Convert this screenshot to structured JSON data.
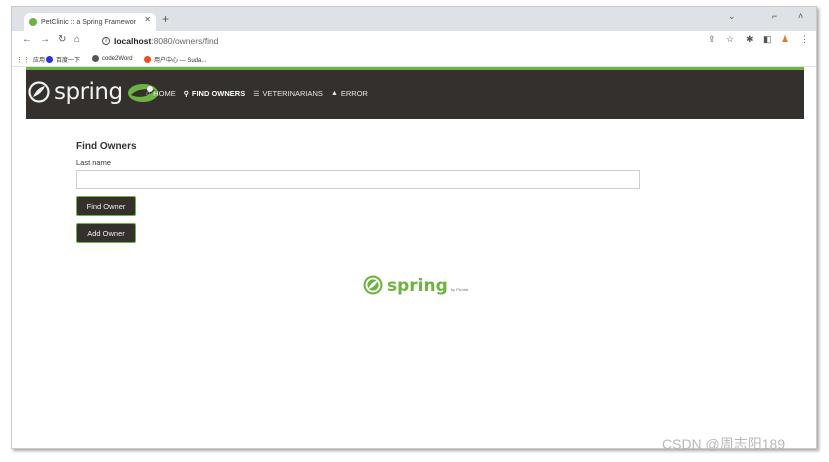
{
  "browser": {
    "tab_title": "PetClinic :: a Spring Framewor",
    "url_host": "localhost",
    "url_path": ":8080/owners/find",
    "bookmarks": [
      "应用",
      "百度一下",
      "code2Word",
      "用户中心 — Suda..."
    ]
  },
  "icons": [
    "back-icon",
    "forward-icon",
    "reload-icon",
    "home-icon",
    "info-icon",
    "share-icon",
    "star-icon",
    "extensions-icon",
    "sidebar-icon",
    "profile-icon",
    "menu-icon",
    "search-icon",
    "list-icon",
    "warning-icon"
  ],
  "navbar": {
    "brand": "spring",
    "links": [
      {
        "label": "HOME",
        "icon": "home-icon",
        "active": false
      },
      {
        "label": "FIND OWNERS",
        "icon": "search-icon",
        "active": true
      },
      {
        "label": "VETERINARIANS",
        "icon": "list-icon",
        "active": false
      },
      {
        "label": "ERROR",
        "icon": "warning-icon",
        "active": false
      }
    ]
  },
  "main": {
    "title": "Find Owners",
    "last_name_label": "Last name",
    "last_name_value": "",
    "find_button": "Find Owner",
    "add_button": "Add Owner"
  },
  "footer": {
    "logo_text": "spring",
    "logo_sub": "by Pivotal."
  },
  "watermark": "CSDN @周志阳189",
  "colors": {
    "accent": "#6db33f",
    "navbar_bg": "#34302d",
    "button_bg": "#34302d"
  }
}
